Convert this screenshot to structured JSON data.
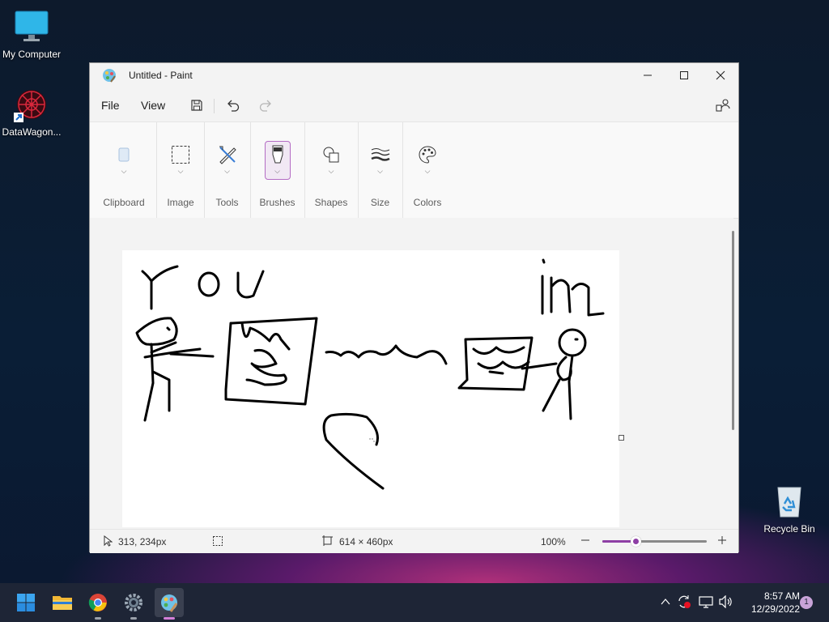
{
  "desktop": {
    "icons": [
      {
        "label": "My Computer"
      },
      {
        "label": "DataWagon..."
      },
      {
        "label": "Recycle Bin"
      }
    ]
  },
  "window": {
    "title": "Untitled - Paint",
    "menu": {
      "file": "File",
      "view": "View"
    },
    "ribbon": {
      "groups": [
        {
          "label": "Clipboard"
        },
        {
          "label": "Image"
        },
        {
          "label": "Tools"
        },
        {
          "label": "Brushes"
        },
        {
          "label": "Shapes"
        },
        {
          "label": "Size"
        },
        {
          "label": "Colors"
        }
      ]
    },
    "canvas_text": {
      "word1": "YOU",
      "word2": "in"
    },
    "status": {
      "cursor_pos": "313, 234px",
      "canvas_size": "614 × 460px",
      "zoom": "100%",
      "zoom_level": 0.32
    }
  },
  "taskbar": {
    "apps": [
      {
        "icon": "windows-start-icon"
      },
      {
        "icon": "file-explorer-icon"
      },
      {
        "icon": "chrome-icon"
      },
      {
        "icon": "settings-icon"
      },
      {
        "icon": "paint-icon"
      }
    ],
    "clock": {
      "time": "8:57 AM",
      "date": "12/29/2022"
    },
    "notification_count": "1"
  },
  "colors": {
    "accent": "#8e3fa5",
    "taskbar": "#1e2536"
  }
}
